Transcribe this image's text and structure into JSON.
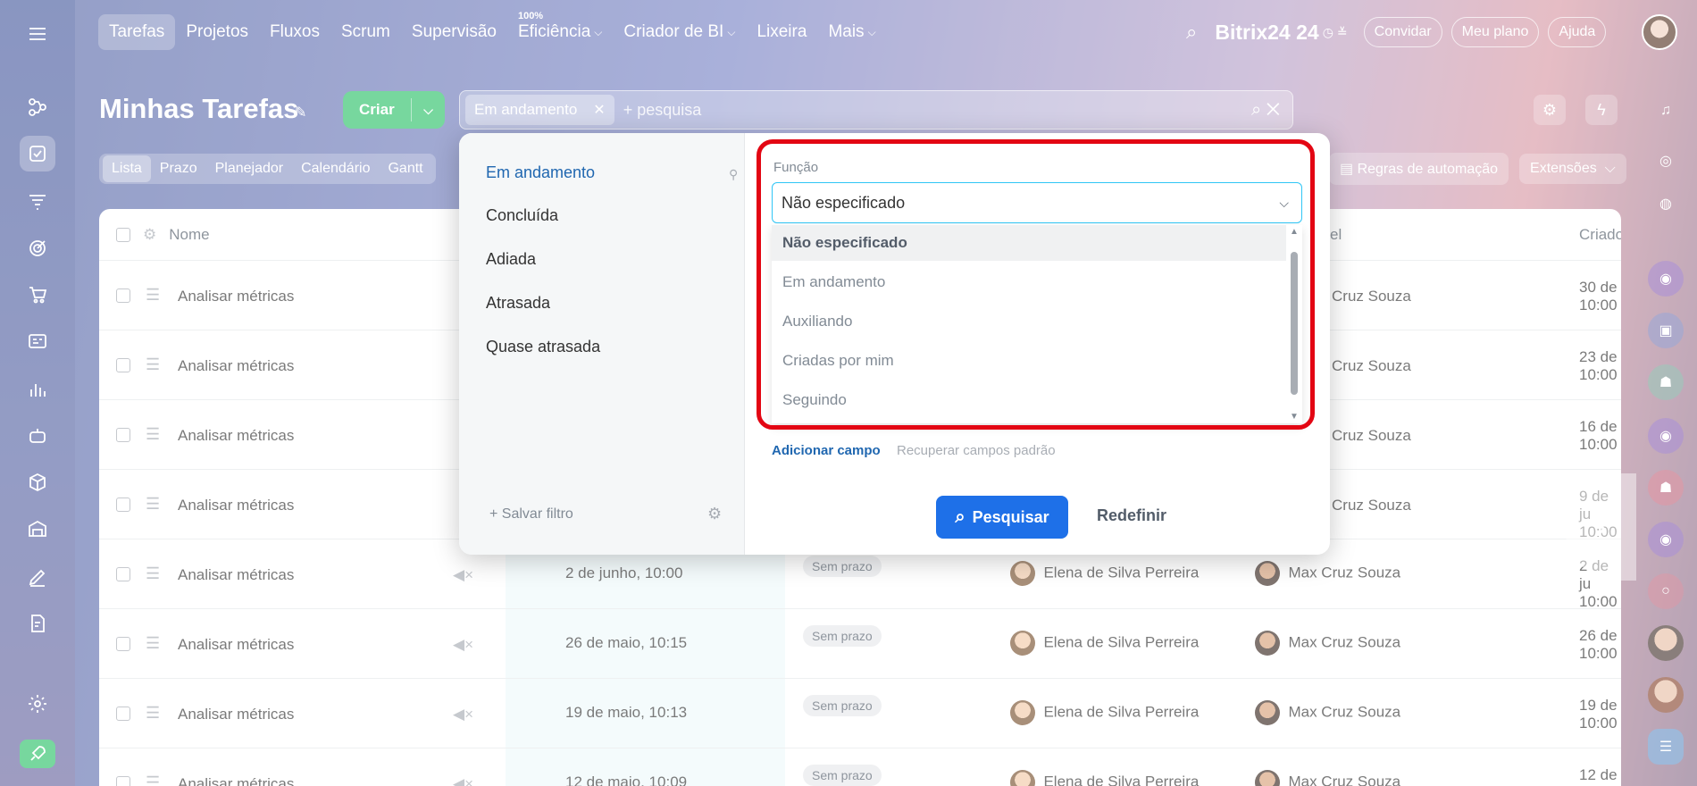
{
  "nav": {
    "items": [
      "Tarefas",
      "Projetos",
      "Fluxos",
      "Scrum",
      "Supervisão",
      "Eficiência",
      "Criador de BI",
      "Lixeira",
      "Mais"
    ],
    "efficiency_badge": "100%"
  },
  "header": {
    "brand": "Bitrix24",
    "brand_num": "24",
    "invite": "Convidar",
    "my_plan": "Meu plano",
    "help": "Ajuda"
  },
  "page": {
    "title": "Minhas Tarefas",
    "create": "Criar"
  },
  "search": {
    "chip": "Em andamento",
    "placeholder": "+ pesquisa"
  },
  "views": [
    "Lista",
    "Prazo",
    "Planejador",
    "Calendário",
    "Gantt"
  ],
  "toolbar": {
    "automation": "Regras de automação",
    "extensions": "Extensões"
  },
  "table": {
    "header_name": "Nome",
    "header_responsible": "el",
    "header_created": "Criado",
    "rows": [
      {
        "name": "Analisar métricas",
        "deadline": "",
        "status": "",
        "creator": "",
        "responsible": "Cruz Souza",
        "created": "30 de",
        "time": "10:00"
      },
      {
        "name": "Analisar métricas",
        "deadline": "",
        "status": "",
        "creator": "",
        "responsible": "Cruz Souza",
        "created": "23 de",
        "time": "10:00"
      },
      {
        "name": "Analisar métricas",
        "deadline": "",
        "status": "",
        "creator": "",
        "responsible": "Cruz Souza",
        "created": "16 de",
        "time": "10:00"
      },
      {
        "name": "Analisar métricas",
        "deadline": "",
        "status": "",
        "creator": "",
        "responsible": "Cruz Souza",
        "created": "9 de ju",
        "time": "10:00"
      },
      {
        "name": "Analisar métricas",
        "deadline": "2 de junho, 10:00",
        "status": "Sem prazo",
        "creator": "Elena de Silva Perreira",
        "responsible": "Max Cruz Souza",
        "created": "2 de ju",
        "time": "10:00"
      },
      {
        "name": "Analisar métricas",
        "deadline": "26 de maio, 10:15",
        "status": "Sem prazo",
        "creator": "Elena de Silva Perreira",
        "responsible": "Max Cruz Souza",
        "created": "26 de",
        "time": "10:00"
      },
      {
        "name": "Analisar métricas",
        "deadline": "19 de maio, 10:13",
        "status": "Sem prazo",
        "creator": "Elena de Silva Perreira",
        "responsible": "Max Cruz Souza",
        "created": "19 de",
        "time": "10:00"
      },
      {
        "name": "Analisar métricas",
        "deadline": "12 de maio, 10:09",
        "status": "Sem prazo",
        "creator": "Elena de Silva Perreira",
        "responsible": "Max Cruz Souza",
        "created": "12 de",
        "time": "10:00"
      }
    ]
  },
  "filter": {
    "presets": [
      "Em andamento",
      "Concluída",
      "Adiada",
      "Atrasada",
      "Quase atrasada"
    ],
    "save_filter": "Salvar filtro",
    "field_label": "Função",
    "selected": "Não especificado",
    "options": [
      "Não especificado",
      "Em andamento",
      "Auxiliando",
      "Criadas por mim",
      "Seguindo"
    ],
    "add_field": "Adicionar campo",
    "restore": "Recuperar campos padrão",
    "search_btn": "Pesquisar",
    "reset_btn": "Redefinir"
  },
  "colors": {
    "accent": "#2fc26b",
    "primary": "#1e70e8",
    "highlight": "#e30613",
    "select_border": "#2fc6f6"
  }
}
